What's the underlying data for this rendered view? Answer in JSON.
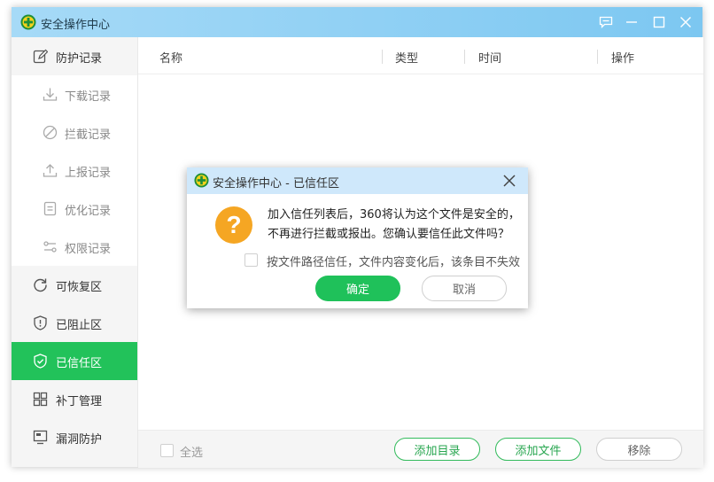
{
  "window": {
    "title": "安全操作中心"
  },
  "sidebar": {
    "items": [
      {
        "label": "防护记录",
        "icon": "edit-icon",
        "level": "top"
      },
      {
        "label": "下载记录",
        "icon": "download-icon",
        "level": "sub"
      },
      {
        "label": "拦截记录",
        "icon": "block-icon",
        "level": "sub"
      },
      {
        "label": "上报记录",
        "icon": "upload-icon",
        "level": "sub"
      },
      {
        "label": "优化记录",
        "icon": "list-icon",
        "level": "sub"
      },
      {
        "label": "权限记录",
        "icon": "key-icon",
        "level": "sub"
      },
      {
        "label": "可恢复区",
        "icon": "restore-icon",
        "level": "top"
      },
      {
        "label": "已阻止区",
        "icon": "shield-alert-icon",
        "level": "top"
      },
      {
        "label": "已信任区",
        "icon": "shield-check-icon",
        "level": "top",
        "active": true
      },
      {
        "label": "补丁管理",
        "icon": "grid-icon",
        "level": "top"
      },
      {
        "label": "漏洞防护",
        "icon": "monitor-icon",
        "level": "top"
      }
    ]
  },
  "table": {
    "columns": [
      "名称",
      "类型",
      "时间",
      "操作"
    ]
  },
  "footer": {
    "select_all": "全选",
    "add_dir": "添加目录",
    "add_file": "添加文件",
    "remove": "移除"
  },
  "dialog": {
    "title": "安全操作中心 - 已信任区",
    "message": "加入信任列表后，360将认为这个文件是安全的，不再进行拦截或报出。您确认要信任此文件吗？",
    "checkbox_label": "按文件路径信任，文件内容变化后，该条目不失效",
    "ok": "确定",
    "cancel": "取消"
  },
  "colors": {
    "accent": "#22c25a",
    "title_bar": "#8fd0f4",
    "warning": "#f5a623"
  }
}
